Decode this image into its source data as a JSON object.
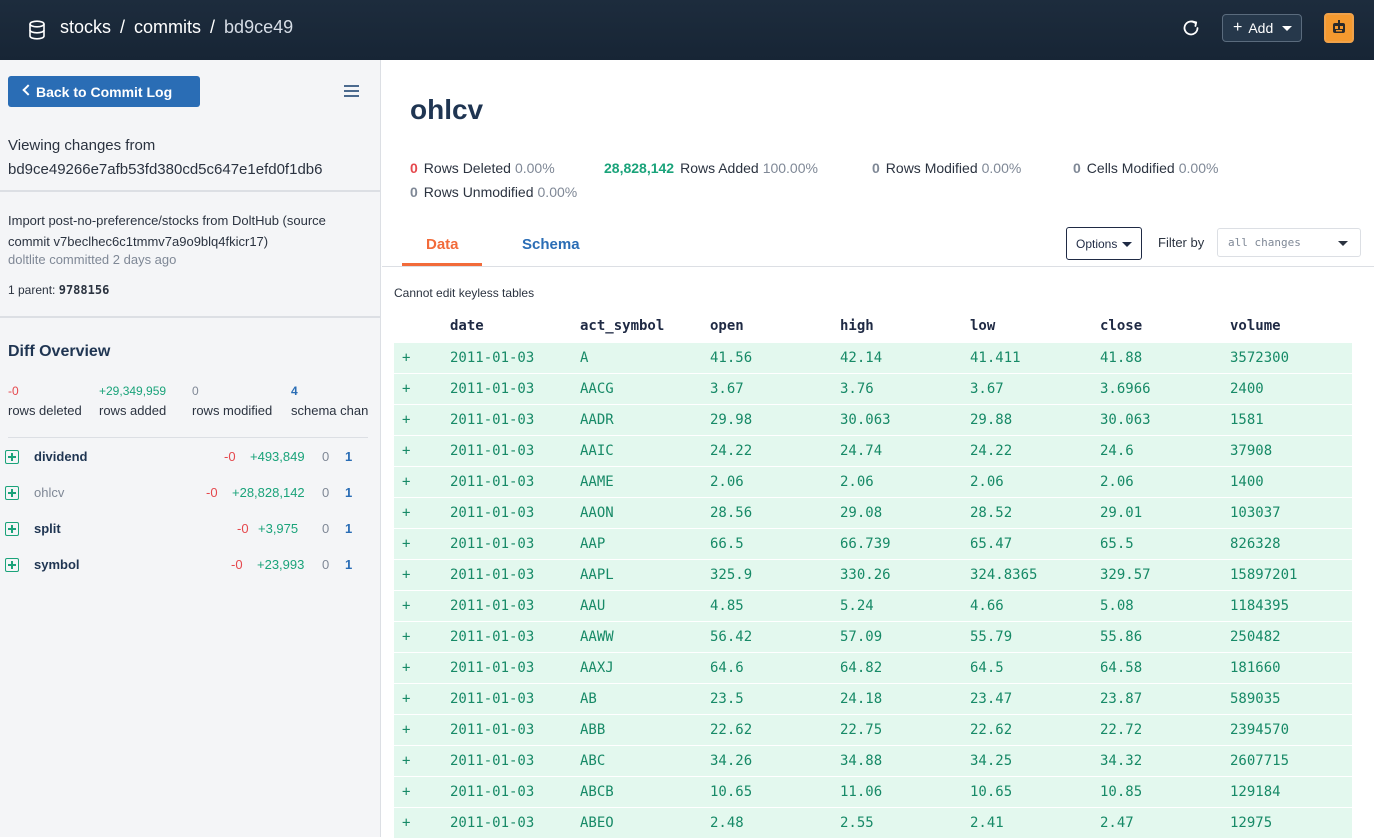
{
  "header": {
    "db_name": "stocks",
    "section": "commits",
    "commit_short": "bd9ce49",
    "add_label": "Add"
  },
  "sidebar": {
    "back_label": "Back to Commit Log",
    "viewing_label": "Viewing changes from",
    "commit_hash": "bd9ce49266e7afb53fd380cd5c647e1efd0f1db6",
    "commit_message": "Import post-no-preference/stocks from DoltHub (source commit v7beclhec6c1tmmv7a9o9blq4fkicr17)",
    "committed_by": "doltlite committed 2 days ago",
    "parent_label": "1 parent:",
    "parent_hash": "9788156",
    "diff_overview_title": "Diff Overview",
    "overview": [
      {
        "value": "-0",
        "label": "rows deleted",
        "color": "#e5484d"
      },
      {
        "value": "+29,349,959",
        "label": "rows added",
        "color": "#1aa37a"
      },
      {
        "value": "0",
        "label": "rows modified",
        "color": "#7f8896"
      },
      {
        "value": "4",
        "label": "schema chan",
        "color": "#2a6db5"
      }
    ],
    "tables": [
      {
        "name": "dividend",
        "deleted": "-0",
        "added": "+493,849",
        "modified": "0",
        "schema": "1",
        "selected": false
      },
      {
        "name": "ohlcv",
        "deleted": "-0",
        "added": "+28,828,142",
        "modified": "0",
        "schema": "1",
        "selected": true
      },
      {
        "name": "split",
        "deleted": "-0",
        "added": "+3,975",
        "modified": "0",
        "schema": "1",
        "selected": false
      },
      {
        "name": "symbol",
        "deleted": "-0",
        "added": "+23,993",
        "modified": "0",
        "schema": "1",
        "selected": false
      }
    ]
  },
  "main": {
    "title": "ohlcv",
    "stats": [
      {
        "num": "0",
        "label": "Rows Deleted",
        "pct": "0.00%",
        "color": "#e5484d"
      },
      {
        "num": "28,828,142",
        "label": "Rows Added",
        "pct": "100.00%",
        "color": "#1aa37a"
      },
      {
        "num": "0",
        "label": "Rows Modified",
        "pct": "0.00%",
        "color": "#7f8896"
      },
      {
        "num": "0",
        "label": "Cells Modified",
        "pct": "0.00%",
        "color": "#7f8896"
      },
      {
        "num": "0",
        "label": "Rows Unmodified",
        "pct": "0.00%",
        "color": "#7f8896"
      }
    ],
    "tabs": {
      "data": "Data",
      "schema": "Schema"
    },
    "options_label": "Options",
    "filter_label": "Filter by",
    "filter_value": "all changes",
    "note": "Cannot edit keyless tables",
    "columns": [
      "date",
      "act_symbol",
      "open",
      "high",
      "low",
      "close",
      "volume"
    ],
    "rows": [
      [
        "+",
        "2011-01-03",
        "A",
        "41.56",
        "42.14",
        "41.411",
        "41.88",
        "3572300"
      ],
      [
        "+",
        "2011-01-03",
        "AACG",
        "3.67",
        "3.76",
        "3.67",
        "3.6966",
        "2400"
      ],
      [
        "+",
        "2011-01-03",
        "AADR",
        "29.98",
        "30.063",
        "29.88",
        "30.063",
        "1581"
      ],
      [
        "+",
        "2011-01-03",
        "AAIC",
        "24.22",
        "24.74",
        "24.22",
        "24.6",
        "37908"
      ],
      [
        "+",
        "2011-01-03",
        "AAME",
        "2.06",
        "2.06",
        "2.06",
        "2.06",
        "1400"
      ],
      [
        "+",
        "2011-01-03",
        "AAON",
        "28.56",
        "29.08",
        "28.52",
        "29.01",
        "103037"
      ],
      [
        "+",
        "2011-01-03",
        "AAP",
        "66.5",
        "66.739",
        "65.47",
        "65.5",
        "826328"
      ],
      [
        "+",
        "2011-01-03",
        "AAPL",
        "325.9",
        "330.26",
        "324.8365",
        "329.57",
        "15897201"
      ],
      [
        "+",
        "2011-01-03",
        "AAU",
        "4.85",
        "5.24",
        "4.66",
        "5.08",
        "1184395"
      ],
      [
        "+",
        "2011-01-03",
        "AAWW",
        "56.42",
        "57.09",
        "55.79",
        "55.86",
        "250482"
      ],
      [
        "+",
        "2011-01-03",
        "AAXJ",
        "64.6",
        "64.82",
        "64.5",
        "64.58",
        "181660"
      ],
      [
        "+",
        "2011-01-03",
        "AB",
        "23.5",
        "24.18",
        "23.47",
        "23.87",
        "589035"
      ],
      [
        "+",
        "2011-01-03",
        "ABB",
        "22.62",
        "22.75",
        "22.62",
        "22.72",
        "2394570"
      ],
      [
        "+",
        "2011-01-03",
        "ABC",
        "34.26",
        "34.88",
        "34.25",
        "34.32",
        "2607715"
      ],
      [
        "+",
        "2011-01-03",
        "ABCB",
        "10.65",
        "11.06",
        "10.65",
        "10.85",
        "129184"
      ],
      [
        "+",
        "2011-01-03",
        "ABEO",
        "2.48",
        "2.55",
        "2.41",
        "2.47",
        "12975"
      ]
    ]
  }
}
